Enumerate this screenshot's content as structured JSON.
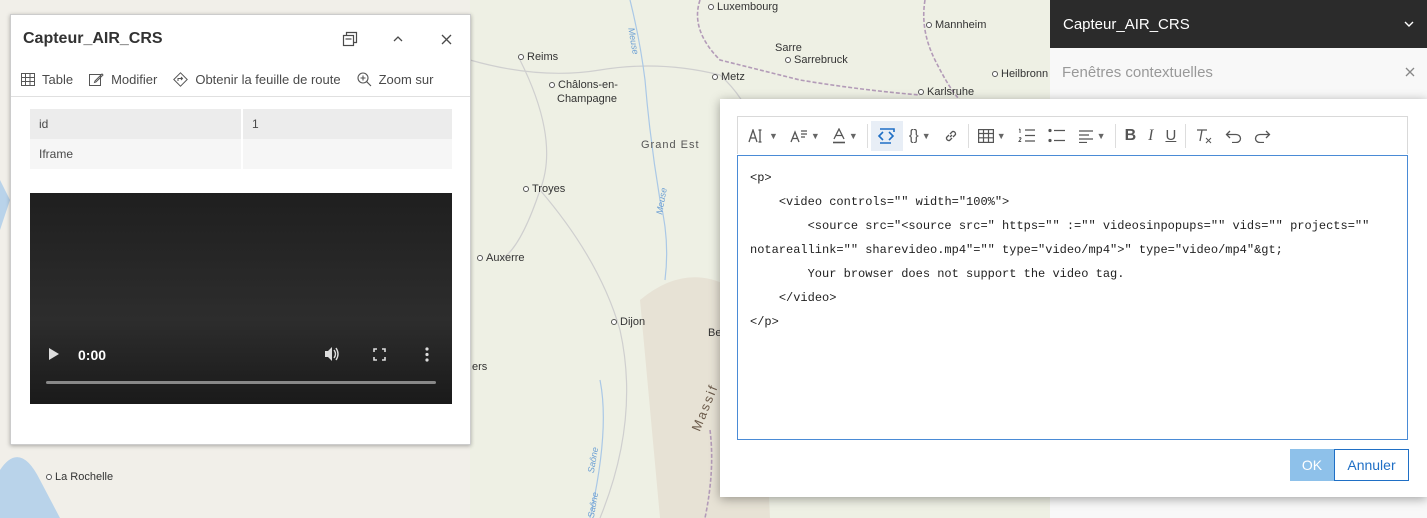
{
  "map": {
    "cities": [
      "Luxembourg",
      "Mannheim",
      "Sarre",
      "Sarrebruck",
      "Reims",
      "Châlons-en-",
      "Champagne",
      "Metz",
      "Heilbronn",
      "Karlsruhe",
      "Troyes",
      "Auxerre",
      "Dijon",
      "Be",
      "La Rochelle",
      "ers"
    ],
    "regions": [
      "Grand Est",
      "Massif"
    ],
    "rivers": [
      "Meuse",
      "Meuse",
      "Saône",
      "Saône"
    ]
  },
  "popup": {
    "title": "Capteur_AIR_CRS",
    "actions": {
      "table": "Table",
      "edit": "Modifier",
      "directions": "Obtenir la feuille de route",
      "zoom": "Zoom sur"
    },
    "attributes": [
      {
        "key": "id",
        "value": "1"
      },
      {
        "key": "Iframe",
        "value": ""
      }
    ],
    "video": {
      "time": "0:00"
    }
  },
  "right_panel": {
    "title": "Capteur_AIR_CRS",
    "subtitle": "Fenêtres contextuelles"
  },
  "dialog": {
    "code_lines": [
      "<p>",
      "    <video controls=\"\" width=\"100%\">",
      "        <source src=\"<source src=\" https=\"\" :=\"\" videosinpopups=\"\" vids=\"\" projects=\"\"",
      "notareallink=\"\" sharevideo.mp4\"=\"\" type=\"video/mp4\">\" type=\"video/mp4\"&gt;",
      "        Your browser does not support the video tag.",
      "    </video>",
      "</p>"
    ],
    "ok_label": "OK",
    "cancel_label": "Annuler"
  },
  "colors": {
    "accent": "#1f6fc5",
    "ok_bg": "#8ec1ea",
    "dark_header": "#2b2b2b"
  }
}
